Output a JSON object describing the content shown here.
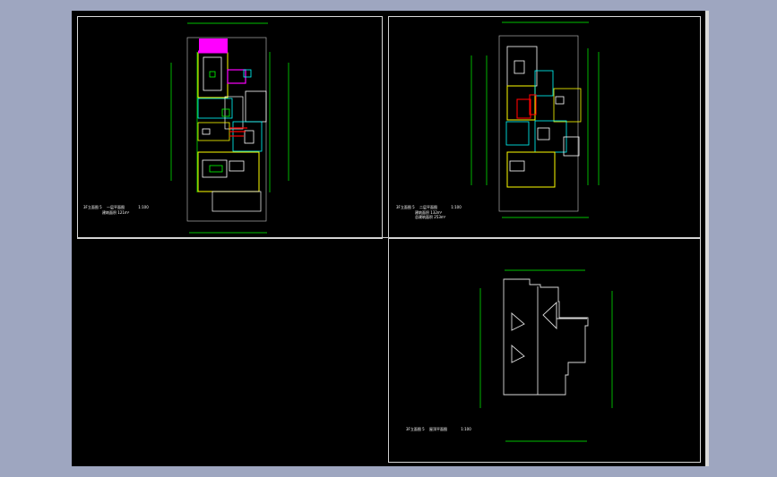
{
  "app": {
    "background_color": "#9ea6c0",
    "canvas_color": "#000000"
  },
  "sheets": [
    {
      "id": "sheet-1",
      "label_left": "3F立面图 5",
      "label_mid": "一层平面图",
      "label_scale": "1:100",
      "label_area": "建筑面积 121m²"
    },
    {
      "id": "sheet-2",
      "label_left": "3F立面图 5",
      "label_mid": "二层平面图",
      "label_scale": "1:100",
      "label_area1": "建筑面积 132m²",
      "label_area2": "总建筑面积 253m²"
    },
    {
      "id": "sheet-3",
      "label_left": "3F立面图 5",
      "label_mid": "屋顶平面图",
      "label_scale": "1:100"
    }
  ],
  "colors": {
    "white": "#ffffff",
    "yellow": "#ffff00",
    "cyan": "#00ffff",
    "magenta": "#ff00ff",
    "green": "#00ff00",
    "red": "#ff0000",
    "blue": "#3b7bff",
    "gray": "#cfcfcf"
  }
}
